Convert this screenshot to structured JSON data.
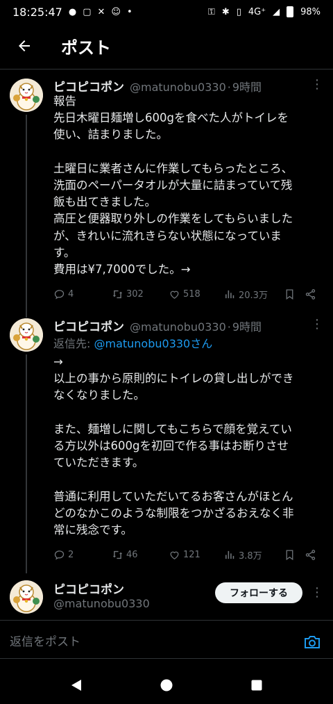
{
  "status_bar": {
    "time": "18:25:47",
    "network": "4G⁺",
    "battery": "98%"
  },
  "header": {
    "title": "ポスト"
  },
  "tweets": [
    {
      "name": "ピコピコポン",
      "handle": "@matunobu0330",
      "time": "9時間",
      "lines": [
        "報告",
        "先日木曜日麺増し600gを食べた人がトイレを",
        "使い、詰まりました。",
        "",
        "土曜日に業者さんに作業してもらったところ、",
        "洗面のペーパータオルが大量に詰まっていて残",
        "飯も出てきました。",
        "高圧と便器取り外しの作業をしてもらいました",
        "が、きれいに流れきらない状態になっていま",
        "す。",
        "費用は¥7,7000でした。→"
      ],
      "replies": "4",
      "reposts": "302",
      "likes": "518",
      "views": "20.3万"
    },
    {
      "name": "ピコピコポン",
      "handle": "@matunobu0330",
      "time": "9時間",
      "reply_prefix": "返信先: ",
      "reply_to": "@matunobu0330さん",
      "lines": [
        "→",
        "以上の事から原則的にトイレの貸し出しができ",
        "なくなりました。",
        "",
        "また、麺増しに関してもこちらで顔を覚えてい",
        "る方以外は600gを初回で作る事はお断りさせ",
        "ていただきます。",
        "",
        "普通に利用していただいてるお客さんがほとん",
        "どのなかこのような制限をつかざるおえなく非",
        "常に残念です。"
      ],
      "replies": "2",
      "reposts": "46",
      "likes": "121",
      "views": "3.8万"
    }
  ],
  "profile": {
    "name": "ピコピコポン",
    "handle": "@matunobu0330",
    "follow_label": "フォローする"
  },
  "reply_bar": {
    "placeholder": "返信をポスト"
  },
  "colors": {
    "accent": "#1d9bf0",
    "background": "#000000",
    "text": "#e7e9ea",
    "muted": "#71767b"
  }
}
